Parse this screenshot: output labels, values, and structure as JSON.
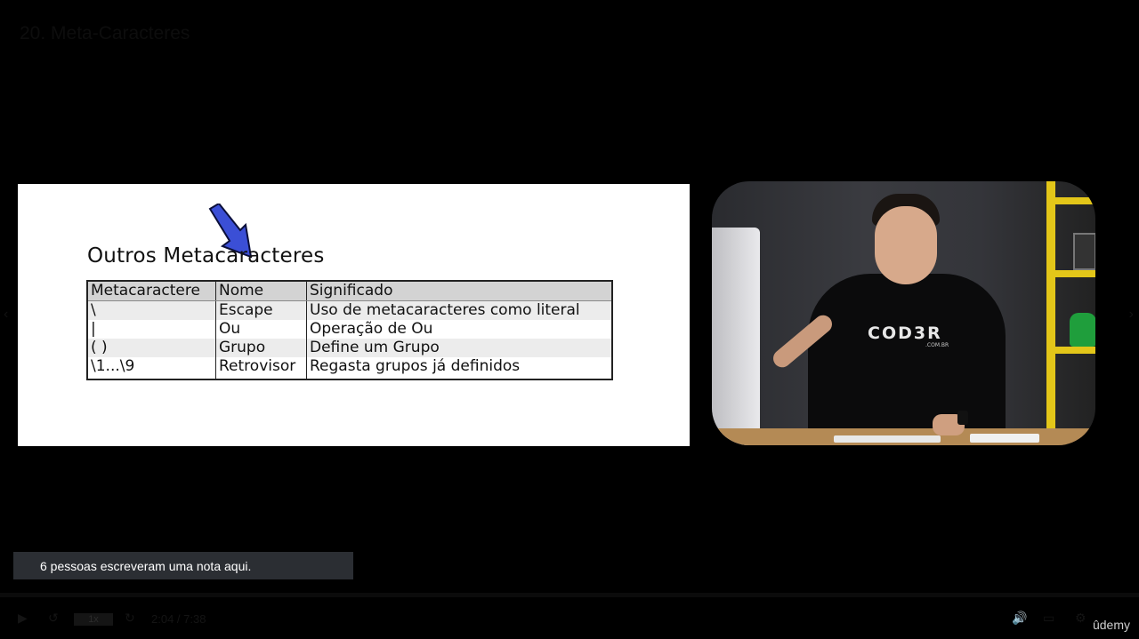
{
  "lecture": {
    "title": "20. Meta-Caracteres"
  },
  "slide": {
    "heading": "Outros Metacaracteres",
    "table": {
      "headers": [
        "Metacaractere",
        "Nome",
        "Significado"
      ],
      "rows": [
        [
          "\\",
          "Escape",
          "Uso de metacaracteres como literal"
        ],
        [
          "|",
          "Ou",
          "Operação de Ou"
        ],
        [
          "( )",
          "Grupo",
          "Define um Grupo"
        ],
        [
          "\\1...\\9",
          "Retrovisor",
          "Regasta grupos já definidos"
        ]
      ]
    }
  },
  "webcam": {
    "shirt_logo": "COD3R",
    "shirt_logo_sub": ".COM.BR"
  },
  "notes": {
    "banner_text": "6 pessoas escreveram uma nota aqui."
  },
  "player": {
    "playback_rate": "1x",
    "time_display": "2:04 / 7:38",
    "brand": "ûdemy",
    "prev_glyph": "‹",
    "next_glyph": "›",
    "play_glyph": "▶",
    "rewind_glyph": "↺",
    "forward_glyph": "↻",
    "volume_glyph": "🔊",
    "captions_glyph": "▭",
    "settings_glyph": "⚙"
  },
  "colors": {
    "slide_bg": "#ffffff",
    "arrow": "#3b4fd6",
    "note_banner_bg": "#2b2e33",
    "accent_yellow": "#e3c619"
  }
}
